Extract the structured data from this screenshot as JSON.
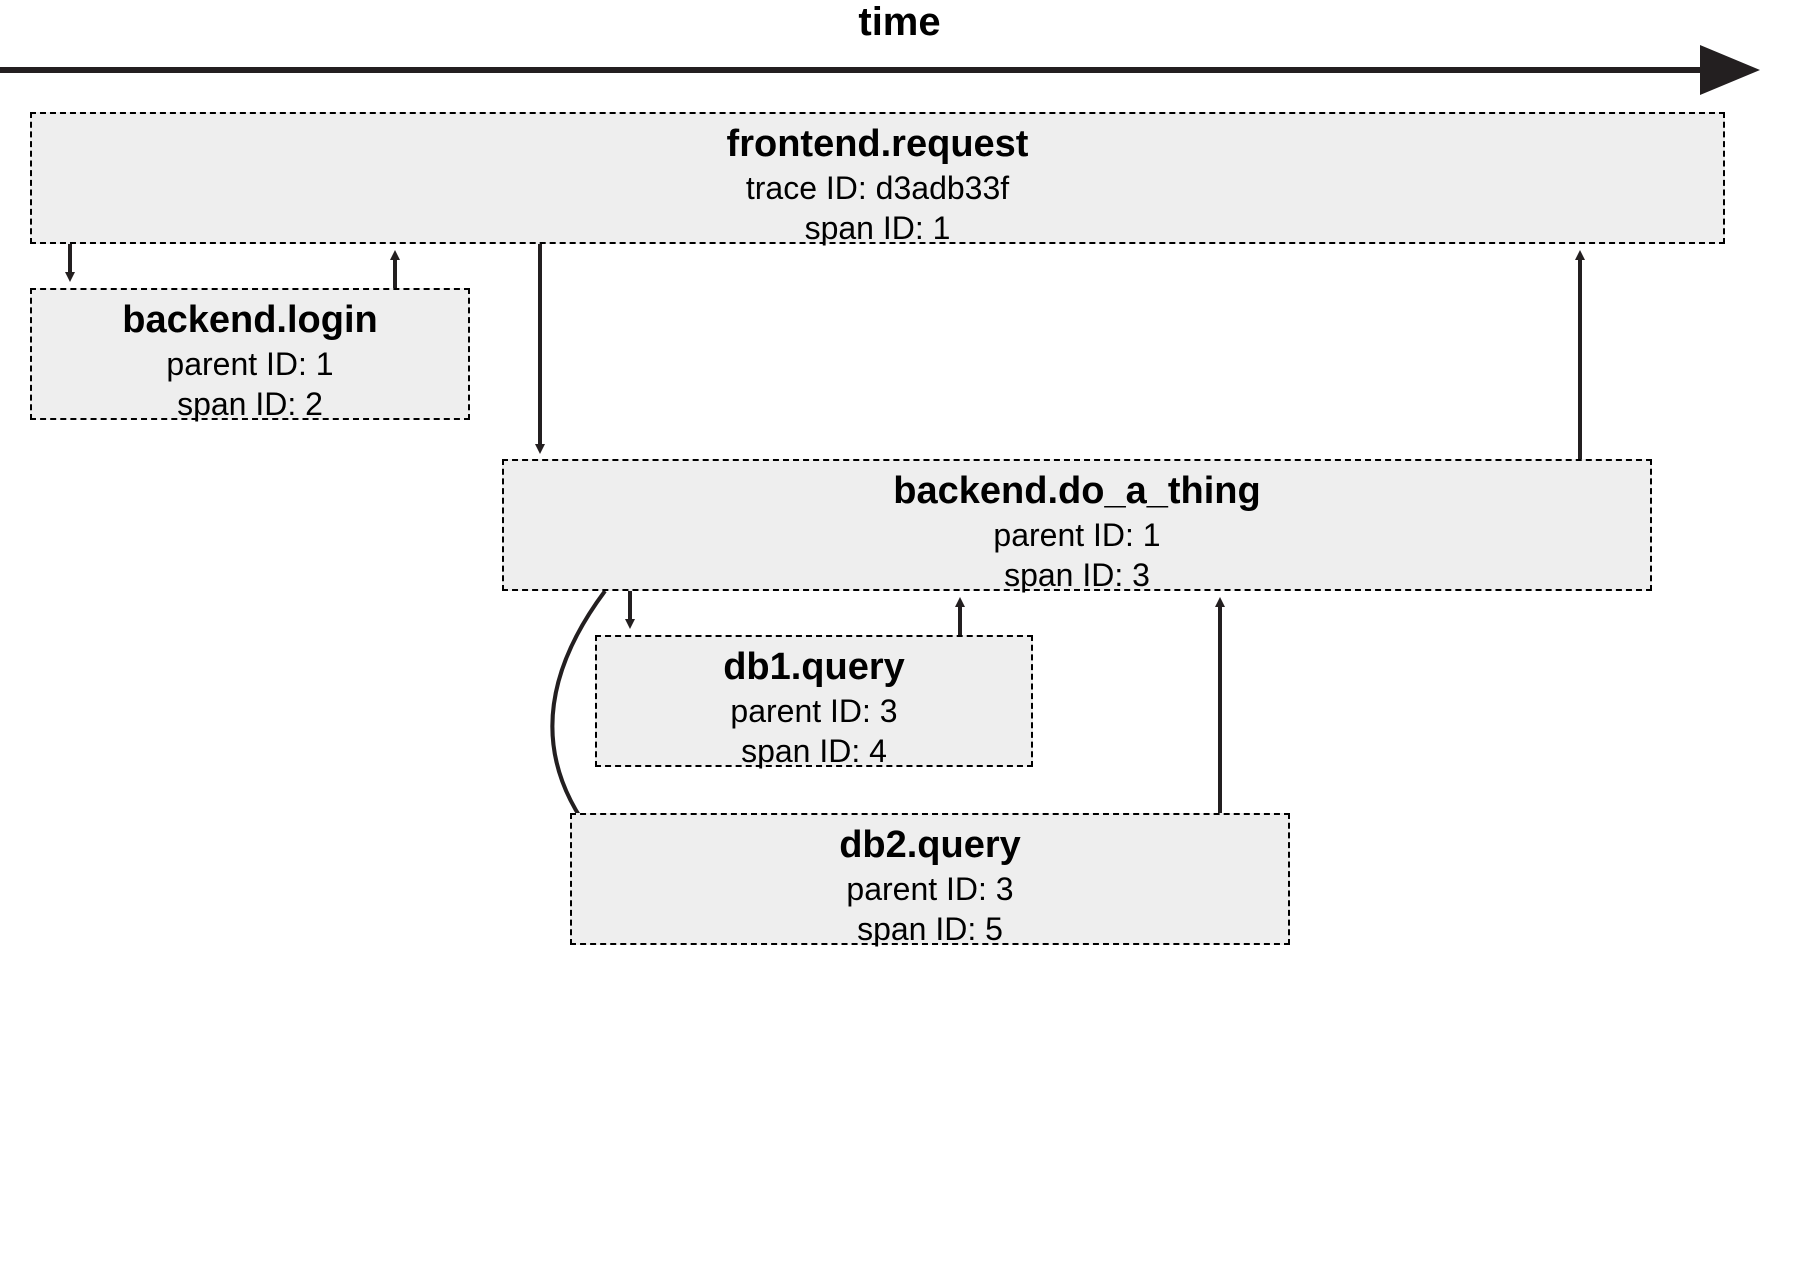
{
  "axis": {
    "label": "time"
  },
  "spans": {
    "frontend_request": {
      "title": "frontend.request",
      "line1": "trace ID: d3adb33f",
      "line2": "span ID: 1"
    },
    "backend_login": {
      "title": "backend.login",
      "line1": "parent ID: 1",
      "line2": "span ID: 2"
    },
    "backend_do_a_thing": {
      "title": "backend.do_a_thing",
      "line1": "parent ID: 1",
      "line2": "span ID: 3"
    },
    "db1_query": {
      "title": "db1.query",
      "line1": "parent ID: 3",
      "line2": "span ID: 4"
    },
    "db2_query": {
      "title": "db2.query",
      "line1": "parent ID: 3",
      "line2": "span ID: 5"
    }
  }
}
